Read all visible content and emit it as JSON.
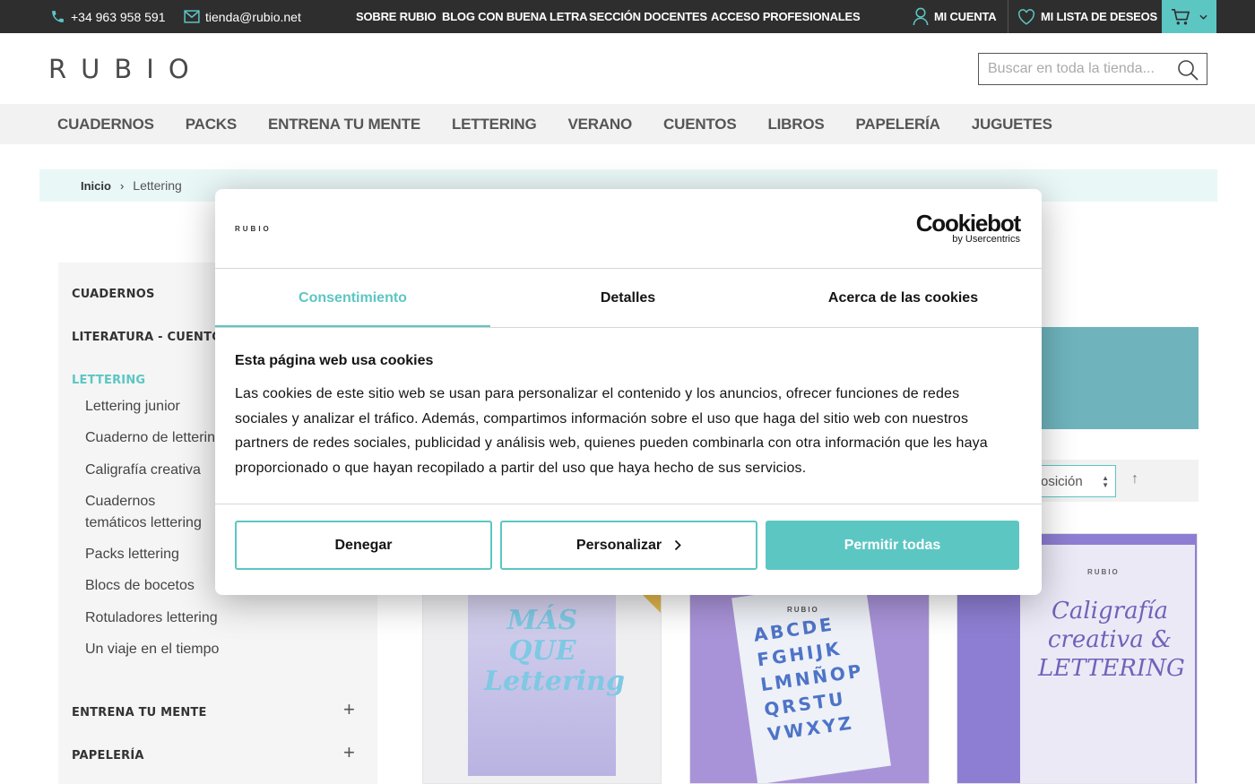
{
  "topbar": {
    "phone": "+34 963 958 591",
    "email": "tienda@rubio.net",
    "links": [
      "SOBRE RUBIO",
      "BLOG CON BUENA LETRA",
      "SECCIÓN DOCENTES",
      "ACCESO PROFESIONALES"
    ],
    "account": "MI CUENTA",
    "wishlist": "MI LISTA DE DESEOS"
  },
  "header": {
    "logo": "RUBIO",
    "search_placeholder": "Buscar en toda la tienda..."
  },
  "nav": [
    "CUADERNOS",
    "PACKS",
    "ENTRENA TU MENTE",
    "LETTERING",
    "VERANO",
    "CUENTOS",
    "LIBROS",
    "PAPELERÍA",
    "JUGUETES"
  ],
  "breadcrumb": {
    "home": "Inicio",
    "separator": "›",
    "current": "Lettering"
  },
  "sidebar": {
    "categories": {
      "cuadernos": "CUADERNOS",
      "literatura": "LITERATURA - CUENTOS",
      "lettering": "LETTERING",
      "entrena": "ENTRENA TU MENTE",
      "papeleria": "PAPELERÍA"
    },
    "lettering_items": [
      "Lettering junior",
      "Cuaderno de lettering",
      "Caligrafía creativa",
      "Cuadernos temáticos lettering",
      "Packs lettering",
      "Blocs de bocetos",
      "Rotuladores lettering",
      "Un viaje en el tiempo"
    ],
    "expand_symbol": "+"
  },
  "toolbar": {
    "sort_value": "osición",
    "sort_direction": "↑"
  },
  "products": {
    "p1_art": "MÁS QUE Lettering",
    "p2_brand": "RUBIO",
    "p2_art": "ABCDE FGHIJK LMNÑOP QRSTU VWXYZ",
    "p3_brand": "RUBIO",
    "p3_art": "Caligrafía creativa & LETTERING"
  },
  "cookie_dialog": {
    "brand_logo": "RUBIO",
    "cookiebot_main": "Cookiebot",
    "cookiebot_sub": "by Usercentrics",
    "tabs": [
      "Consentimiento",
      "Detalles",
      "Acerca de las cookies"
    ],
    "heading": "Esta página web usa cookies",
    "body": "Las cookies de este sitio web se usan para personalizar el contenido y los anuncios, ofrecer funciones de redes sociales y analizar el tráfico. Además, compartimos información sobre el uso que haga del sitio web con nuestros partners de redes sociales, publicidad y análisis web, quienes pueden combinarla con otra información que les haya proporcionado o que hayan recopilado a partir del uso que haya hecho de sus servicios.",
    "deny": "Denegar",
    "customize": "Personalizar",
    "allow_all": "Permitir todas"
  },
  "colors": {
    "accent": "#5cc6c3",
    "topbar_bg": "#2e2e2e"
  }
}
